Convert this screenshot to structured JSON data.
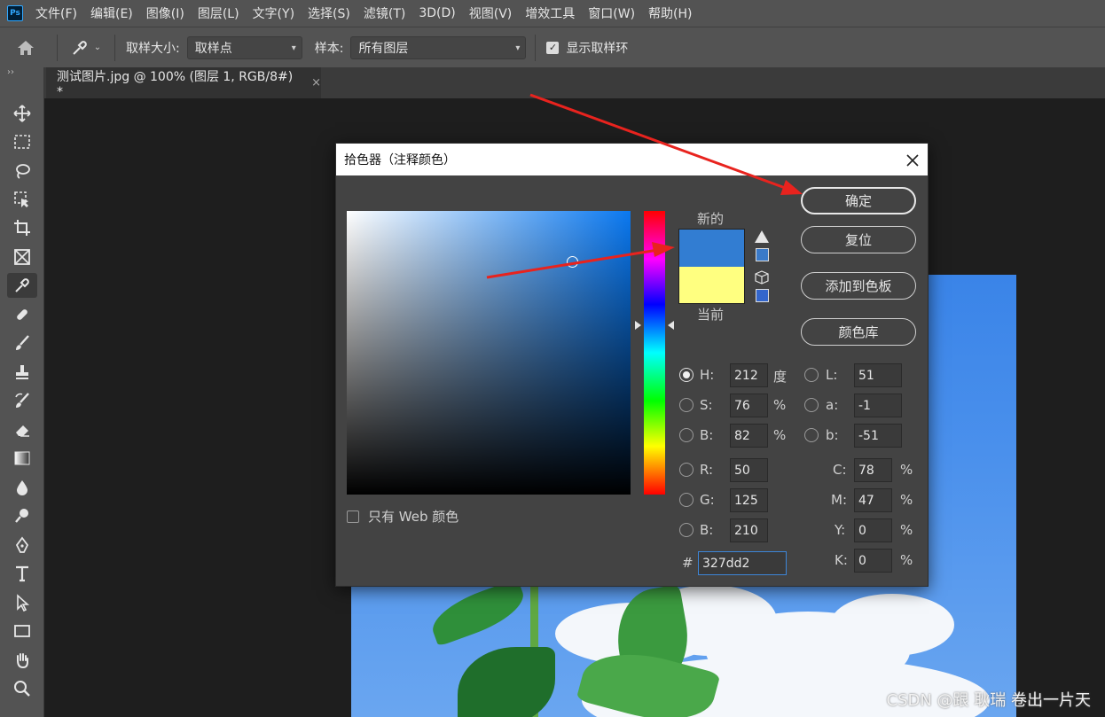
{
  "menubar": {
    "items": [
      "文件(F)",
      "编辑(E)",
      "图像(I)",
      "图层(L)",
      "文字(Y)",
      "选择(S)",
      "滤镜(T)",
      "3D(D)",
      "视图(V)",
      "增效工具",
      "窗口(W)",
      "帮助(H)"
    ]
  },
  "optbar": {
    "sample_size_label": "取样大小:",
    "sample_size_value": "取样点",
    "sample_label": "样本:",
    "sample_value": "所有图层",
    "show_ring_label": "显示取样环"
  },
  "document": {
    "tab_title": "测试图片.jpg @ 100% (图层 1, RGB/8#) *",
    "close_glyph": "×"
  },
  "dialog": {
    "title": "拾色器（注释颜色）",
    "new_label": "新的",
    "current_label": "当前",
    "buttons": {
      "ok": "确定",
      "reset": "复位",
      "add_to_swatches": "添加到色板",
      "color_libraries": "颜色库"
    },
    "hsb": {
      "h_label": "H:",
      "h_value": "212",
      "h_unit": "度",
      "s_label": "S:",
      "s_value": "76",
      "s_unit": "%",
      "b_label": "B:",
      "b_value": "82",
      "b_unit": "%"
    },
    "lab": {
      "l_label": "L:",
      "l_value": "51",
      "a_label": "a:",
      "a_value": "-1",
      "b_label": "b:",
      "b_value": "-51"
    },
    "rgb": {
      "r_label": "R:",
      "r_value": "50",
      "g_label": "G:",
      "g_value": "125",
      "b_label": "B:",
      "b_value": "210"
    },
    "cmyk": {
      "c_label": "C:",
      "c_value": "78",
      "m_label": "M:",
      "m_value": "47",
      "y_label": "Y:",
      "y_value": "0",
      "k_label": "K:",
      "k_value": "0",
      "unit": "%"
    },
    "hex_label": "#",
    "hex_value": "327dd2",
    "web_only_label": "只有 Web 颜色",
    "new_color": "#327dd2",
    "current_color": "#ffff80"
  },
  "watermark": "CSDN @跟 耿瑞 卷出一片天",
  "colors": {
    "annotation_arrow": "#e8231e",
    "ui_bg": "#535353",
    "dialog_bg": "#434343"
  }
}
